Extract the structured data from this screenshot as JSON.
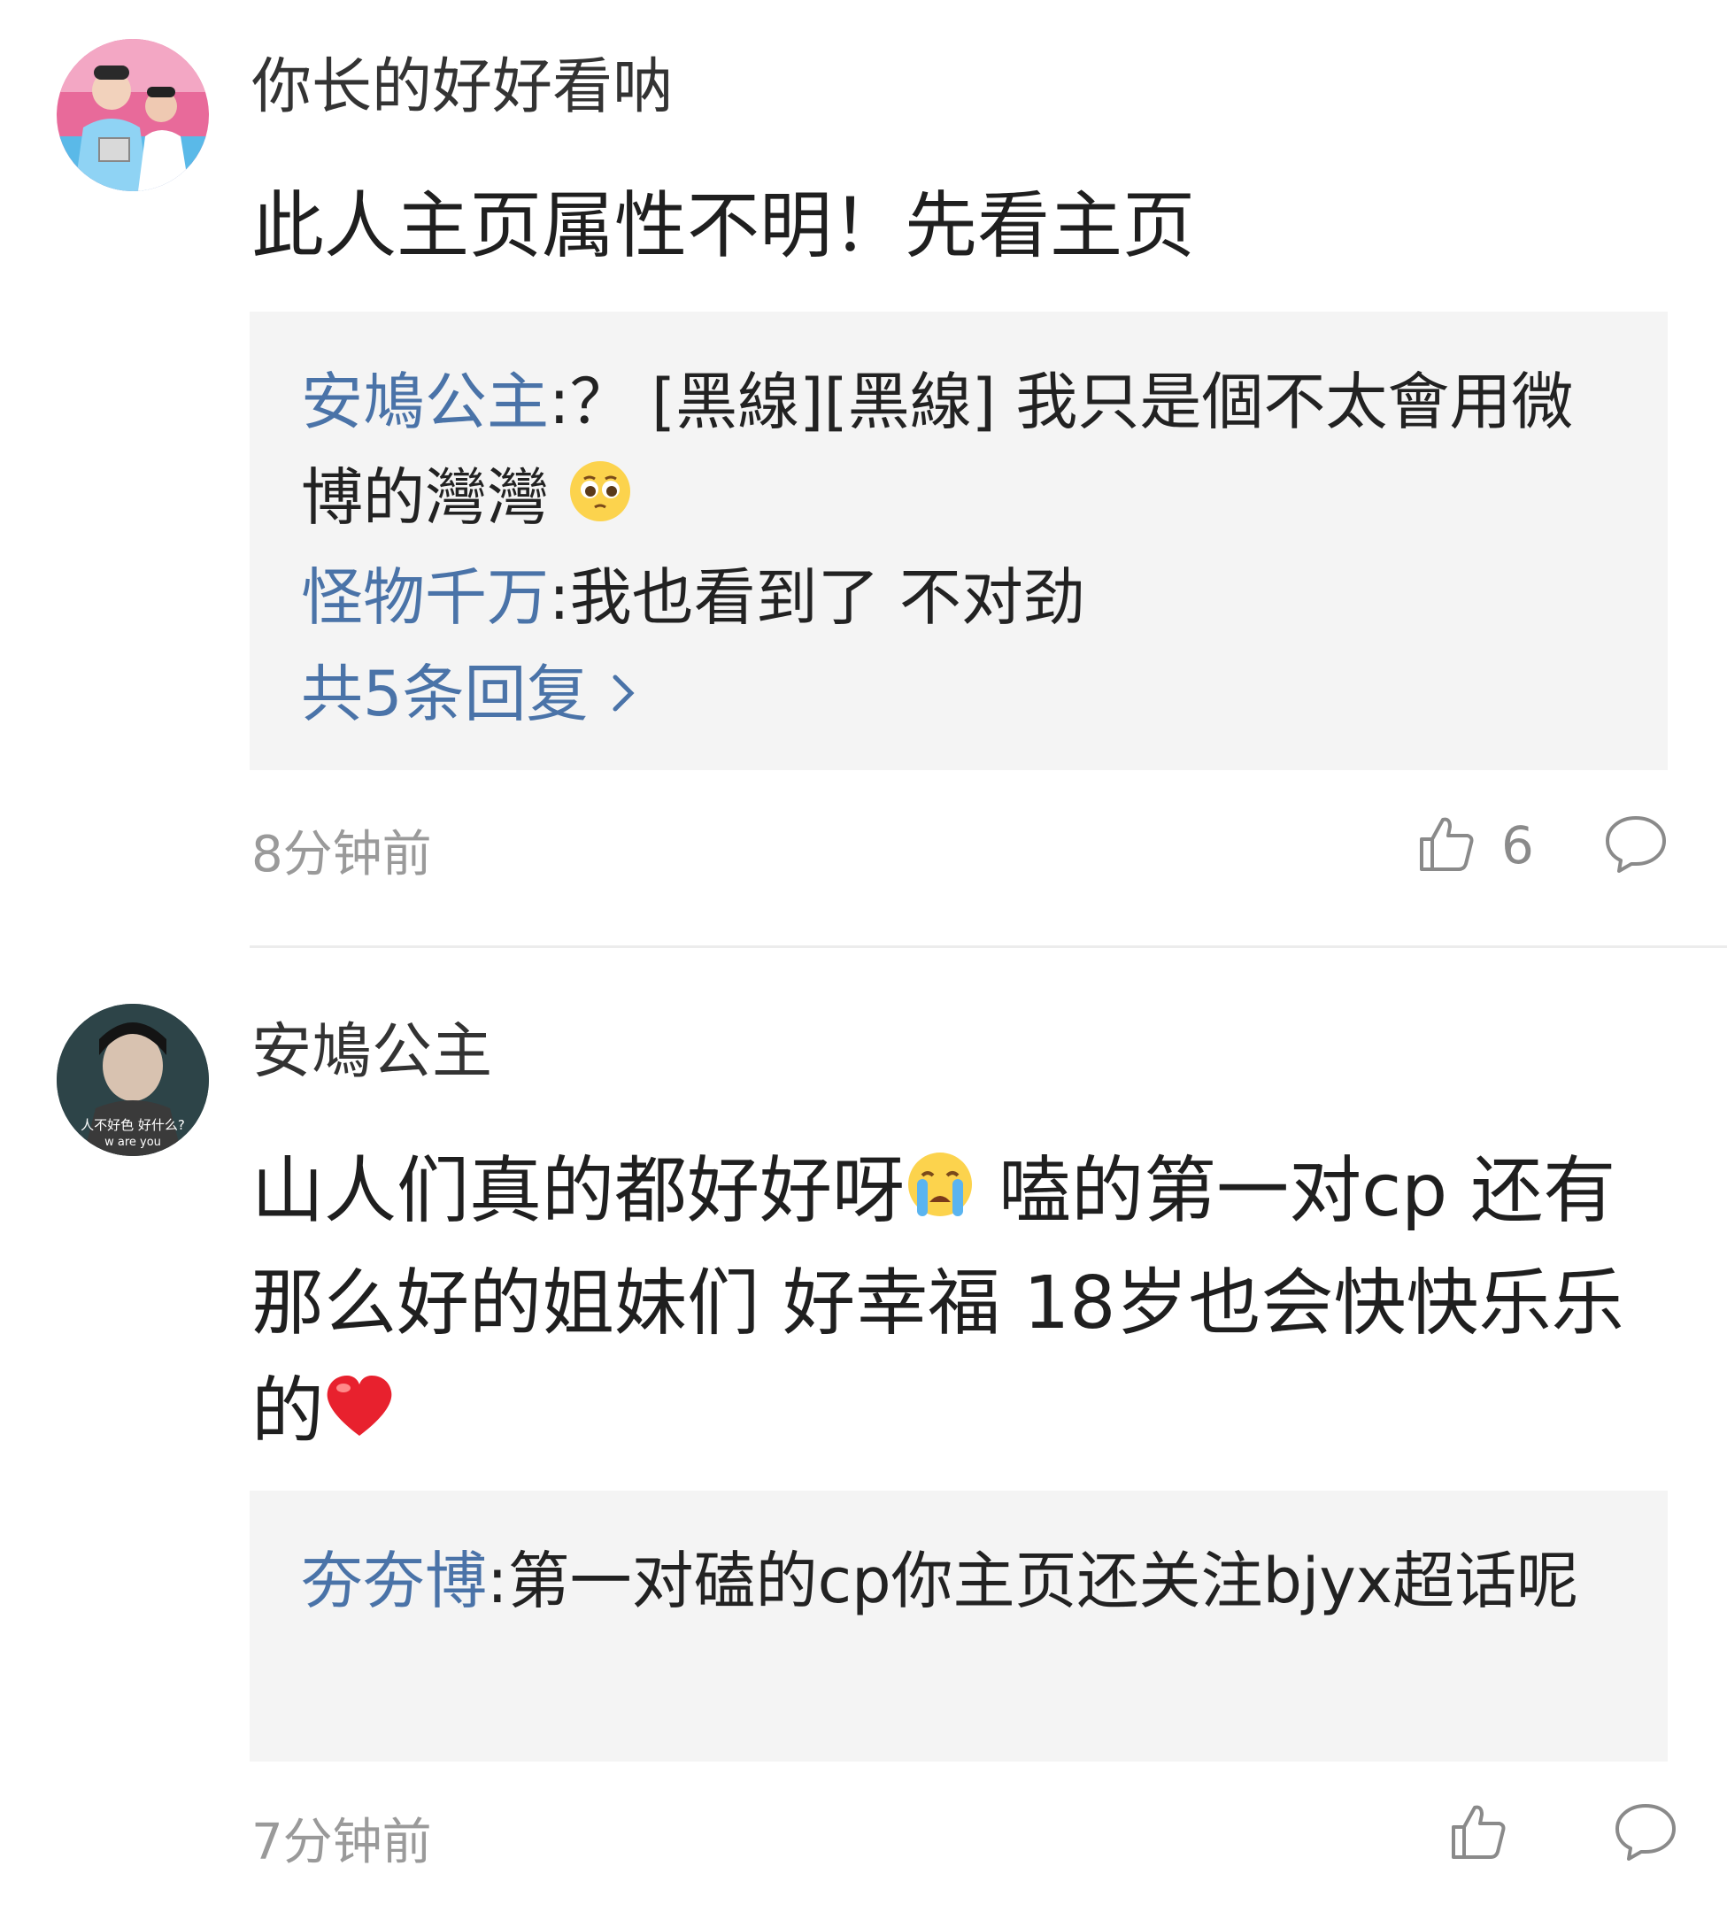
{
  "comments": [
    {
      "username": "你长的好好看呐",
      "avatar": "avatar-two-boys",
      "text": "此人主页属性不明！先看主页",
      "replies": [
        {
          "name": "安鳩公主",
          "text": ":？ [黑線][黑線] 我只是個不太會用微博的灣灣",
          "emoji": "pleading-face-emoji"
        },
        {
          "name": "怪物千万",
          "text": ":我也看到了 不对劲"
        }
      ],
      "more_replies": "共5条回复",
      "time": "8分钟前",
      "likes": "6"
    },
    {
      "username": "安鳩公主",
      "avatar": "avatar-drama-still",
      "avatar_caption": "人不好色 好什么?",
      "avatar_subcaption": "w are you",
      "text_part1": "山人们真的都好好呀",
      "emoji1": "loudly-crying-emoji",
      "text_part2": " 嗑的第一对cp 还有那么好的姐妹们 好幸福 18岁也会快快乐乐的",
      "emoji2": "red-heart-emoji",
      "replies": [
        {
          "name": "夯夯博",
          "text": ":第一对磕的cp你主页还关注bjyx超话呢"
        }
      ],
      "time": "7分钟前",
      "likes": ""
    }
  ],
  "colors": {
    "link_blue": "#4a73a8",
    "reply_bg": "#f4f4f4",
    "meta_gray": "#9a9a9a"
  }
}
